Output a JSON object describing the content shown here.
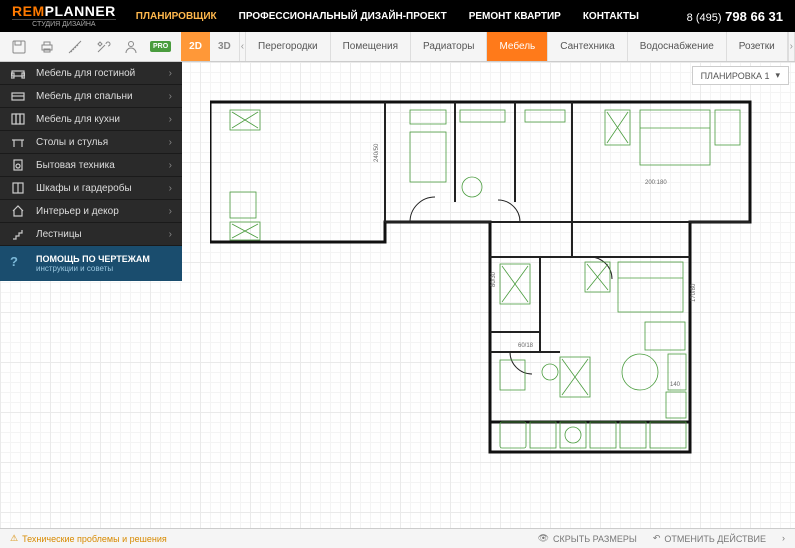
{
  "header": {
    "logo_main_1": "REM",
    "logo_main_2": "PLANNER",
    "logo_sub": "СТУДИЯ ДИЗАЙНА",
    "nav": [
      {
        "label": "ПЛАНИРОВЩИК",
        "active": true
      },
      {
        "label": "ПРОФЕССИОНАЛЬНЫЙ ДИЗАЙН-ПРОЕКТ",
        "active": false
      },
      {
        "label": "РЕМОНТ КВАРТИР",
        "active": false
      },
      {
        "label": "КОНТАКТЫ",
        "active": false
      }
    ],
    "phone_prefix": "8 (495)",
    "phone_main": "798 66 31"
  },
  "toolbar": {
    "pro_label": "PRO",
    "view_2d": "2D",
    "view_3d": "3D",
    "tabs": [
      {
        "label": "Перегородки",
        "active": false
      },
      {
        "label": "Помещения",
        "active": false
      },
      {
        "label": "Радиаторы",
        "active": false
      },
      {
        "label": "Мебель",
        "active": true
      },
      {
        "label": "Сантехника",
        "active": false
      },
      {
        "label": "Водоснабжение",
        "active": false
      },
      {
        "label": "Розетки",
        "active": false
      }
    ]
  },
  "sidebar": {
    "items": [
      {
        "label": "Мебель для гостиной"
      },
      {
        "label": "Мебель для спальни"
      },
      {
        "label": "Мебель для кухни"
      },
      {
        "label": "Столы и стулья"
      },
      {
        "label": "Бытовая техника"
      },
      {
        "label": "Шкафы и гардеробы"
      },
      {
        "label": "Интерьер и декор"
      },
      {
        "label": "Лестницы"
      }
    ],
    "help_title": "ПОМОЩЬ ПО ЧЕРТЕЖАМ",
    "help_sub": "инструкции и советы"
  },
  "canvas": {
    "layout_label": "ПЛАНИРОВКА 1",
    "dims": {
      "top_right": "200:180",
      "left_vert": "240/50",
      "mid_right": "170/80",
      "bottom_right": "140",
      "mid_left": "80/30",
      "mid_center": "60/18"
    }
  },
  "footer": {
    "warning": "Технические проблемы и решения",
    "hide_dims": "СКРЫТЬ РАЗМЕРЫ",
    "undo": "ОТМЕНИТЬ ДЕЙСТВИЕ"
  }
}
